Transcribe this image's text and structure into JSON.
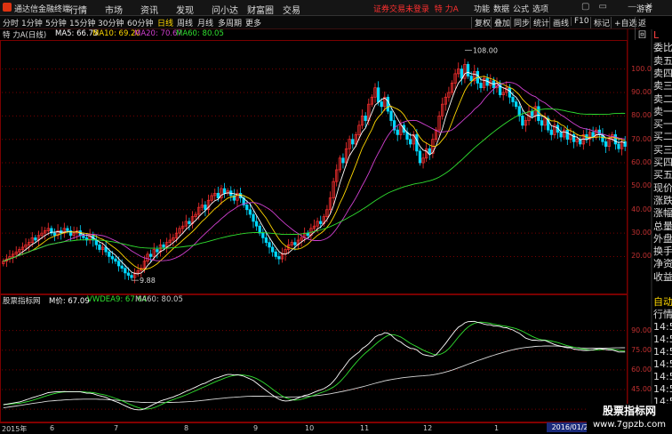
{
  "app": {
    "name": "通达信金融终端"
  },
  "menu": [
    "行情",
    "市场",
    "资讯",
    "发现",
    "问小达",
    "财富圈",
    "交易"
  ],
  "login_status": "证券交易未登录",
  "stock_label": "特 力A",
  "right_menu": [
    "功能",
    "数据",
    "公式",
    "选项"
  ],
  "guest_label": "游客",
  "periods": [
    "分时",
    "1分钟",
    "5分钟",
    "15分钟",
    "30分钟",
    "60分钟",
    "日线",
    "周线",
    "月线",
    "多周期",
    "更多"
  ],
  "selected_period": "日线",
  "right_tools": [
    "复权",
    "叠加",
    "同步",
    "统计",
    "画线",
    "F10",
    "标记",
    "+自选",
    "返回"
  ],
  "main_info": {
    "title": "特 力A(日线)",
    "ma5": "MA5: 66.75",
    "ma10": "MA10: 69.20",
    "ma20": "MA20: 70.67",
    "ma60": "MA60: 80.05"
  },
  "price_ticks": [
    "100.0",
    "90.00",
    "80.00",
    "70.00",
    "60.00",
    "50.00",
    "40.00",
    "30.00",
    "20.00"
  ],
  "annotations": {
    "high": "108.00",
    "low": "9.88"
  },
  "sub_info": {
    "name": "股票指标网",
    "m": "M价: 67.09",
    "vwdea": "VWDEA9: 67.64",
    "ma60": "MA60: 80.05"
  },
  "sub_ticks": [
    "90.00",
    "75.00",
    "60.00",
    "45.00",
    "30.00"
  ],
  "sidebar": {
    "top": [
      "L",
      "委比",
      "卖五",
      "卖四",
      "卖三",
      "卖二",
      "卖一",
      "买一",
      "买二",
      "买三",
      "买四",
      "买五",
      "现价",
      "涨跌",
      "涨幅",
      "总量",
      "外盘",
      "换手",
      "净资",
      "收益"
    ],
    "bottom": [
      "自动",
      "行情",
      "14:5",
      "14:5",
      "14:5",
      "14:5",
      "14:5",
      "14:5",
      "14:5",
      "14:5"
    ]
  },
  "months": [
    "2015年",
    "6",
    "7",
    "8",
    "9",
    "10",
    "11",
    "12",
    "1"
  ],
  "date_box": "2016/01/27/",
  "watermark": {
    "line1": "股票指标网",
    "line2": "www.7gpzb.com"
  },
  "colors": {
    "up": "#ff3030",
    "down": "#00d8ff",
    "ma5": "#ffffff",
    "ma10": "#ffd800",
    "ma20": "#d040d0",
    "ma60": "#30e030",
    "grid": "#7a0000"
  },
  "chart_data": {
    "type": "line",
    "ylim": [
      5,
      112
    ],
    "close": [
      18,
      19,
      20,
      21,
      22,
      23,
      24,
      25,
      26,
      28,
      27,
      29,
      30,
      31,
      32,
      30,
      29,
      31,
      30,
      32,
      31,
      29,
      30,
      31,
      29,
      28,
      27,
      29,
      27,
      25,
      23,
      24,
      22,
      20,
      19,
      18,
      16,
      15,
      13,
      12,
      11,
      13,
      14,
      15,
      18,
      21,
      20,
      23,
      22,
      25,
      24,
      26,
      27,
      28,
      30,
      32,
      33,
      35,
      34,
      37,
      38,
      41,
      42,
      40,
      44,
      46,
      47,
      45,
      49,
      47,
      48,
      46,
      44,
      47,
      45,
      42,
      40,
      38,
      35,
      33,
      30,
      28,
      26,
      24,
      22,
      20,
      19,
      21,
      23,
      25,
      26,
      25,
      27,
      28,
      30,
      29,
      32,
      33,
      35,
      34,
      37,
      40,
      45,
      52,
      57,
      62,
      60,
      66,
      70,
      68,
      72,
      76,
      80,
      78,
      85,
      88,
      92,
      86,
      84,
      88,
      82,
      78,
      74,
      72,
      76,
      73,
      70,
      68,
      72,
      65,
      60,
      62,
      66,
      64,
      70,
      74,
      80,
      85,
      88,
      90,
      94,
      98,
      100,
      96,
      102,
      97,
      95,
      99,
      94,
      92,
      96,
      93,
      95,
      92,
      94,
      89,
      90,
      92,
      88,
      86,
      84,
      80,
      76,
      78,
      82,
      80,
      84,
      78,
      76,
      79,
      74,
      72,
      76,
      73,
      71,
      74,
      70,
      72,
      69,
      70,
      68,
      72,
      70,
      73,
      71,
      74,
      72,
      69,
      67,
      70,
      72,
      68,
      66,
      69,
      67
    ],
    "low_point": 9.88,
    "high_point": 108.0,
    "sub_ylim": [
      22,
      108
    ]
  }
}
